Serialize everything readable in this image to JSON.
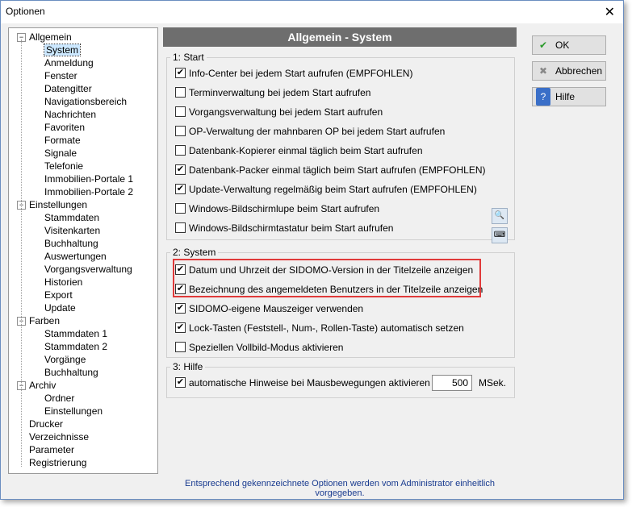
{
  "window": {
    "title": "Optionen"
  },
  "tree": [
    {
      "label": "Allgemein",
      "level": 0,
      "expander": "−"
    },
    {
      "label": "System",
      "level": 1,
      "selected": true
    },
    {
      "label": "Anmeldung",
      "level": 1
    },
    {
      "label": "Fenster",
      "level": 1
    },
    {
      "label": "Datengitter",
      "level": 1
    },
    {
      "label": "Navigationsbereich",
      "level": 1
    },
    {
      "label": "Nachrichten",
      "level": 1
    },
    {
      "label": "Favoriten",
      "level": 1
    },
    {
      "label": "Formate",
      "level": 1
    },
    {
      "label": "Signale",
      "level": 1
    },
    {
      "label": "Telefonie",
      "level": 1
    },
    {
      "label": "Immobilien-Portale 1",
      "level": 1
    },
    {
      "label": "Immobilien-Portale 2",
      "level": 1
    },
    {
      "label": "Einstellungen",
      "level": 0,
      "expander": "−"
    },
    {
      "label": "Stammdaten",
      "level": 1
    },
    {
      "label": "Visitenkarten",
      "level": 1
    },
    {
      "label": "Buchhaltung",
      "level": 1
    },
    {
      "label": "Auswertungen",
      "level": 1
    },
    {
      "label": "Vorgangsverwaltung",
      "level": 1
    },
    {
      "label": "Historien",
      "level": 1
    },
    {
      "label": "Export",
      "level": 1
    },
    {
      "label": "Update",
      "level": 1
    },
    {
      "label": "Farben",
      "level": 0,
      "expander": "−"
    },
    {
      "label": "Stammdaten 1",
      "level": 1
    },
    {
      "label": "Stammdaten 2",
      "level": 1
    },
    {
      "label": "Vorgänge",
      "level": 1
    },
    {
      "label": "Buchhaltung",
      "level": 1
    },
    {
      "label": "Archiv",
      "level": 0,
      "expander": "−"
    },
    {
      "label": "Ordner",
      "level": 1
    },
    {
      "label": "Einstellungen",
      "level": 1
    },
    {
      "label": "Drucker",
      "level": 0
    },
    {
      "label": "Verzeichnisse",
      "level": 0
    },
    {
      "label": "Parameter",
      "level": 0
    },
    {
      "label": "Registrierung",
      "level": 0
    }
  ],
  "panel": {
    "title": "Allgemein - System",
    "groups": {
      "start": {
        "label": "1: Start",
        "options": [
          {
            "label": "Info-Center bei jedem Start aufrufen (EMPFOHLEN)",
            "checked": true
          },
          {
            "label": "Terminverwaltung bei jedem Start aufrufen",
            "checked": false
          },
          {
            "label": "Vorgangsverwaltung bei jedem Start aufrufen",
            "checked": false
          },
          {
            "label": "OP-Verwaltung der mahnbaren OP bei jedem Start aufrufen",
            "checked": false
          },
          {
            "label": "Datenbank-Kopierer einmal täglich beim Start aufrufen",
            "checked": false
          },
          {
            "label": "Datenbank-Packer einmal täglich beim Start aufrufen (EMPFOHLEN)",
            "checked": true
          },
          {
            "label": "Update-Verwaltung regelmäßig beim Start aufrufen (EMPFOHLEN)",
            "checked": true
          },
          {
            "label": "Windows-Bildschirmlupe beim Start aufrufen",
            "checked": false
          },
          {
            "label": "Windows-Bildschirmtastatur beim Start aufrufen",
            "checked": false
          }
        ]
      },
      "system": {
        "label": "2: System",
        "options": [
          {
            "label": "Datum und Uhrzeit der SIDOMO-Version in der Titelzeile anzeigen",
            "checked": true
          },
          {
            "label": "Bezeichnung des angemeldeten Benutzers in der Titelzeile anzeigen",
            "checked": true
          },
          {
            "label": "SIDOMO-eigene Mauszeiger verwenden",
            "checked": true
          },
          {
            "label": "Lock-Tasten (Feststell-, Num-, Rollen-Taste) automatisch setzen",
            "checked": true
          },
          {
            "label": "Speziellen Vollbild-Modus aktivieren",
            "checked": false
          }
        ]
      },
      "help": {
        "label": "3: Hilfe",
        "option": {
          "label": "automatische Hinweise bei Mausbewegungen aktivieren nach",
          "checked": true
        },
        "value": "500",
        "unit": "MSek."
      }
    }
  },
  "footer": "Entsprechend gekennzeichnete Optionen werden vom Administrator einheitlich vorgegeben.",
  "buttons": {
    "ok": {
      "label": "OK",
      "icon": "check-icon"
    },
    "cancel": {
      "label": "Abbrechen",
      "icon": "cancel-x-icon"
    },
    "help": {
      "label": "Hilfe",
      "icon": "help-icon"
    }
  },
  "colors": {
    "panel_header": "#6e6e6e",
    "highlight": "#e03a3a",
    "footer_text": "#1a3c90"
  }
}
